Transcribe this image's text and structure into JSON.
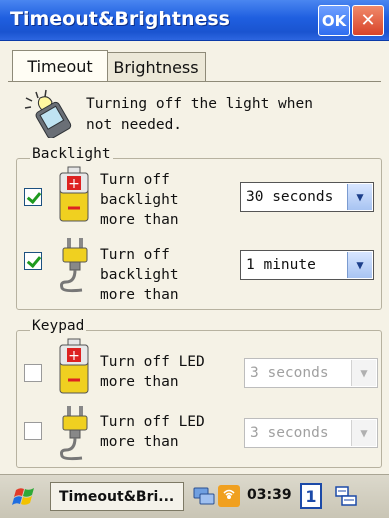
{
  "window": {
    "title": "Timeout&Brightness",
    "ok_label": "OK",
    "close_glyph": "✕"
  },
  "tabs": [
    {
      "label": "Timeout",
      "selected": true
    },
    {
      "label": "Brightness",
      "selected": false
    }
  ],
  "info": {
    "text": "Turning off the light when\nnot needed.",
    "icon": "device-light-icon"
  },
  "backlight": {
    "group_label": "Backlight",
    "rows": [
      {
        "checked": true,
        "label": "Turn off\nbacklight\nmore than",
        "value": "30 seconds",
        "icon": "battery-icon"
      },
      {
        "checked": true,
        "label": "Turn off\nbacklight\nmore than",
        "value": "1 minute",
        "icon": "power-plug-icon"
      }
    ]
  },
  "keypad": {
    "group_label": "Keypad",
    "rows": [
      {
        "checked": false,
        "label": "Turn off LED\nmore than",
        "value": "3 seconds",
        "icon": "battery-icon"
      },
      {
        "checked": false,
        "label": "Turn off LED\nmore than",
        "value": "3 seconds",
        "icon": "power-plug-icon"
      }
    ]
  },
  "taskbar": {
    "task_label": "Timeout&Bri...",
    "clock": "03:39",
    "input_number": "1",
    "icons": [
      "start-flag-icon",
      "network-icon",
      "signal-icon",
      "keyboard-icon"
    ]
  },
  "colors": {
    "title_bar": "#1f5fe0",
    "check": "#1f9a1f",
    "background": "#f5f2e6"
  }
}
